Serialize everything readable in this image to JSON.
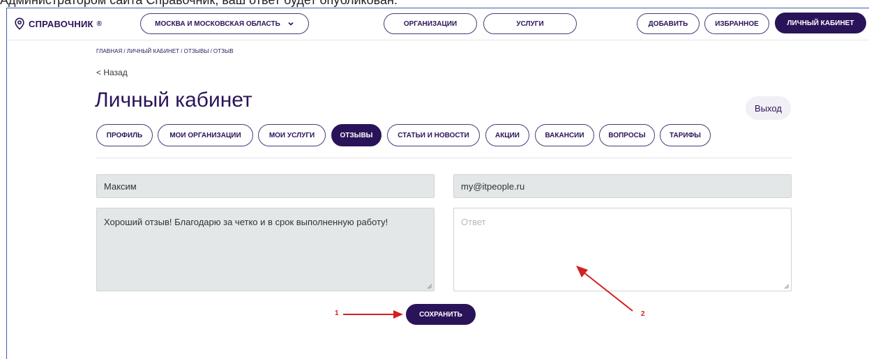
{
  "caption": "Администратором сайта Справочник, ваш ответ будет опубликован.",
  "header": {
    "logo_text": "СПРАВОЧНИК",
    "logo_mark": "®",
    "region": "МОСКВА И МОСКОВСКАЯ ОБЛАСТЬ",
    "nav": [
      "ОРГАНИЗАЦИИ",
      "УСЛУГИ"
    ],
    "add_label": "ДОБАВИТЬ",
    "favorites_label": "ИЗБРАННОЕ",
    "cabinet_label": "ЛИЧНЫЙ КАБИНЕТ"
  },
  "breadcrumb": [
    "ГЛАВНАЯ",
    "ЛИЧНЫЙ КАБИНЕТ",
    "ОТЗЫВЫ",
    "ОТЗЫВ"
  ],
  "back_label": "< Назад",
  "page_title": "Личный кабинет",
  "logout_label": "Выход",
  "tabs": [
    {
      "label": "ПРОФИЛЬ"
    },
    {
      "label": "МОИ ОРГАНИЗАЦИИ"
    },
    {
      "label": "МОИ УСЛУГИ"
    },
    {
      "label": "ОТЗЫВЫ",
      "active": true
    },
    {
      "label": "СТАТЬИ И НОВОСТИ"
    },
    {
      "label": "АКЦИИ"
    },
    {
      "label": "ВАКАНСИИ"
    },
    {
      "label": "ВОПРОСЫ"
    },
    {
      "label": "ТАРИФЫ"
    }
  ],
  "form": {
    "name_value": "Максим",
    "email_value": "my@itpeople.ru",
    "review_text": "Хороший отзыв! Благодарю за четко и в срок выполненную работу!",
    "answer_placeholder": "Ответ",
    "save_label": "СОХРАНИТЬ"
  },
  "annotations": {
    "label_1": "1",
    "label_2": "2",
    "color": "#d42020"
  },
  "colors": {
    "brand": "#2a1459",
    "field_bg": "#e3e7e7"
  }
}
